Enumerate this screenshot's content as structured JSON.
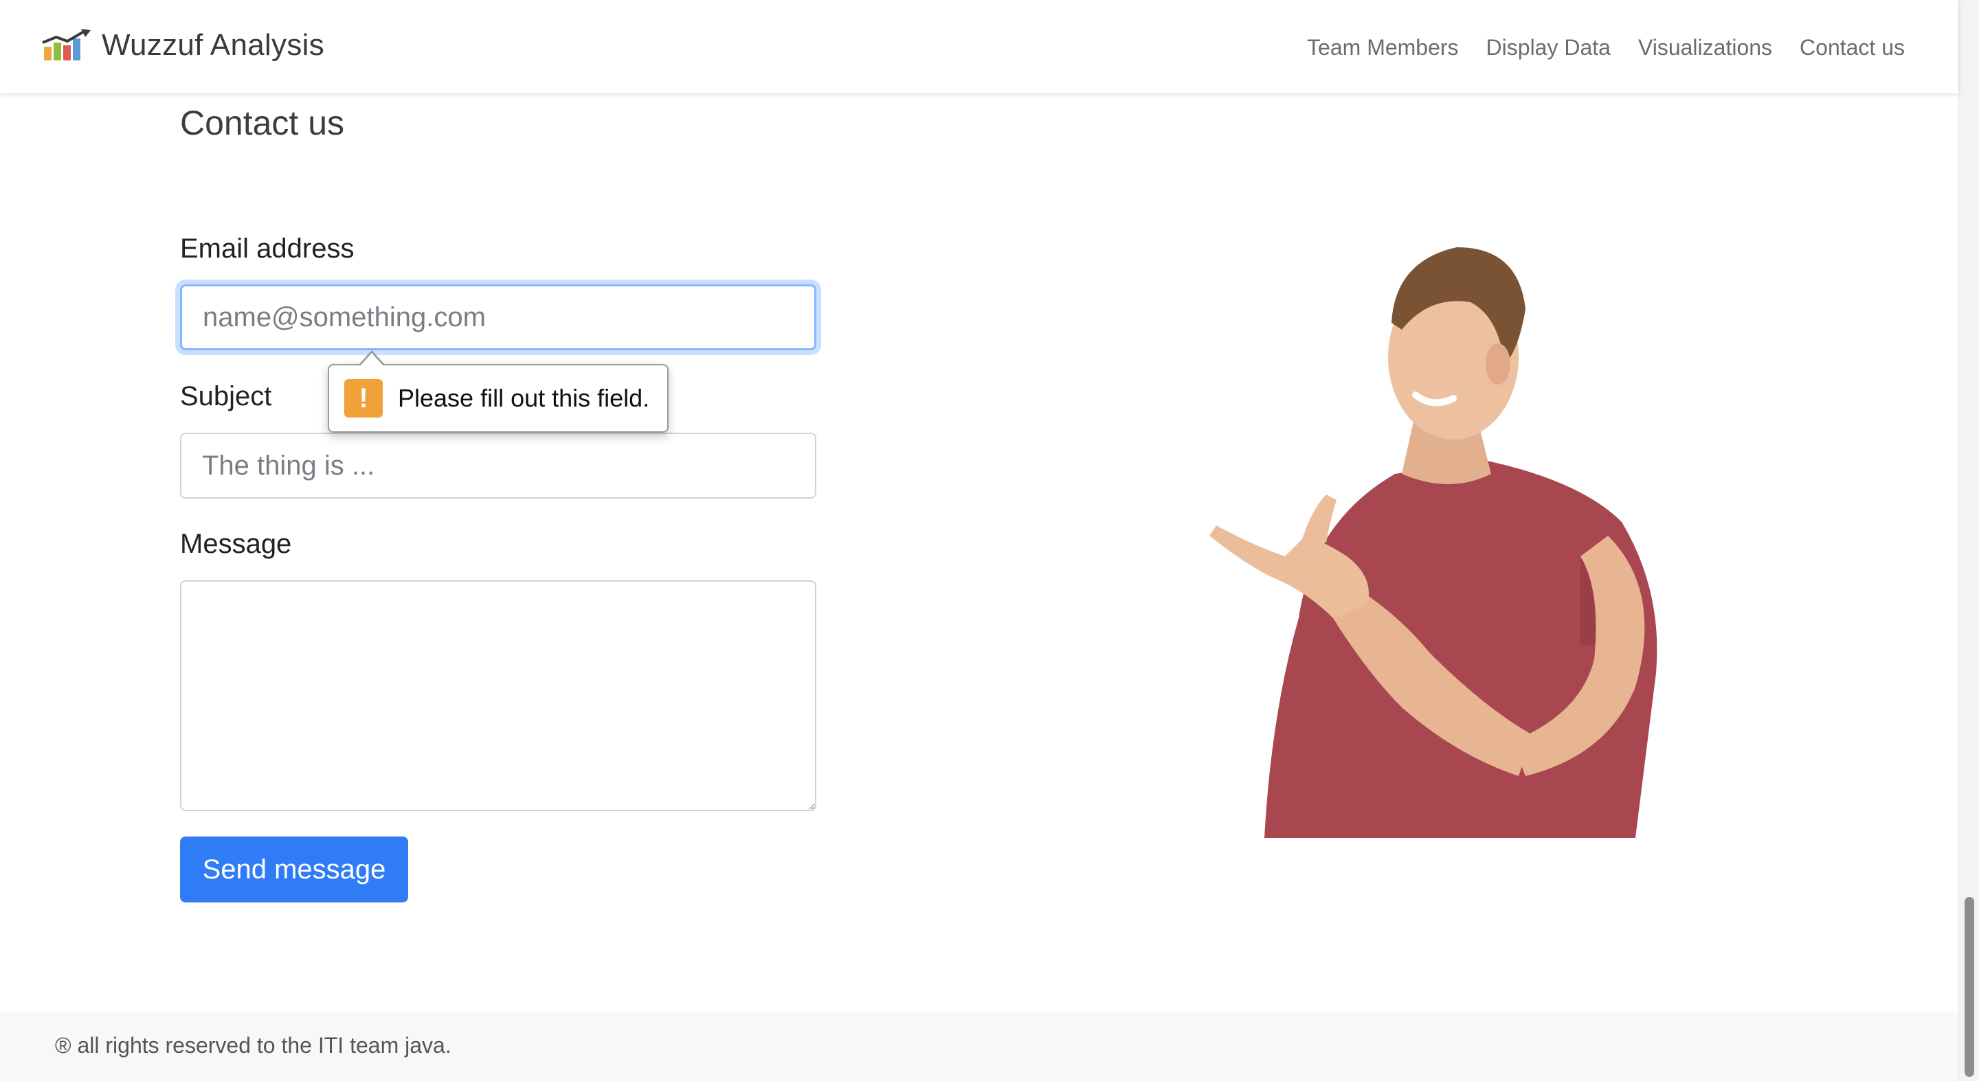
{
  "navbar": {
    "brand": "Wuzzuf Analysis",
    "logo_icon": "bar-chart-trend-icon",
    "links": [
      "Team Members",
      "Display Data",
      "Visualizations",
      "Contact us"
    ]
  },
  "page": {
    "title": "Contact us"
  },
  "form": {
    "email_label": "Email address",
    "email_placeholder": "name@something.com",
    "email_value": "",
    "subject_label": "Subject",
    "subject_placeholder": "The thing is ...",
    "subject_value": "",
    "message_label": "Message",
    "message_value": "",
    "send_label": "Send message"
  },
  "validation": {
    "message": "Please fill out this field.",
    "icon": "warning-icon",
    "icon_glyph": "!"
  },
  "footer": {
    "text": "® all rights reserved to the ITI team java."
  },
  "colors": {
    "primary": "#2f7cf6",
    "focus_ring": "#86b7fe",
    "warning": "#f0a23a",
    "shirt": "#a8474f"
  }
}
